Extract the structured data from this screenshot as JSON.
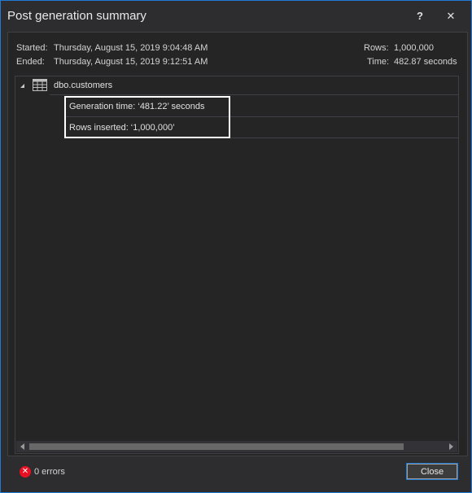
{
  "window": {
    "title": "Post generation summary",
    "help_label": "?",
    "close_label": "✕"
  },
  "summary": {
    "started_label": "Started:",
    "started_value": "Thursday, August 15, 2019 9:04:48 AM",
    "ended_label": "Ended:",
    "ended_value": "Thursday, August 15, 2019 9:12:51 AM",
    "rows_label": "Rows:",
    "rows_value": "1,000,000",
    "time_label": "Time:",
    "time_value": "482.87 seconds"
  },
  "tree": {
    "node_label": "dbo.customers",
    "node_icon": "table-icon",
    "details": [
      "Generation time: ‘481.22’ seconds",
      "Rows inserted: ‘1,000,000’"
    ]
  },
  "status": {
    "errors_text": "0 errors",
    "error_icon": "error-icon",
    "error_color": "#e81123"
  },
  "buttons": {
    "close_label": "Close"
  },
  "colors": {
    "accent": "#1e7ad4",
    "background": "#2d2d30"
  }
}
